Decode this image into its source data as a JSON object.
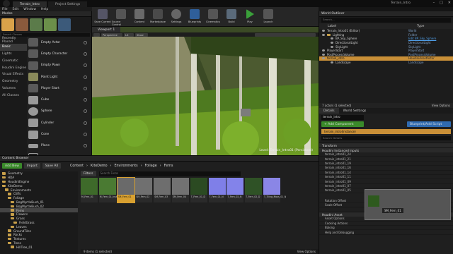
{
  "window": {
    "level_tab": "Terrain_Intro",
    "second_tab": "Project Settings",
    "menus": [
      "File",
      "Edit",
      "Window",
      "Help"
    ]
  },
  "modes": {
    "title": "Modes",
    "search_placeholder": "Search Classes",
    "categories": [
      "Recently Placed",
      "Basic",
      "Lights",
      "Cinematic",
      "Houdini Engine",
      "Visual Effects",
      "Geometry",
      "Volumes",
      "All Classes"
    ],
    "selected_category": "Basic",
    "items": [
      "Empty Actor",
      "Empty Character",
      "Empty Pawn",
      "Point Light",
      "Player Start",
      "Cube",
      "Sphere",
      "Cylinder",
      "Cone",
      "Plane",
      "Box Trigger"
    ]
  },
  "toolbar": {
    "buttons": [
      "Save Current",
      "Source Control",
      "Content",
      "Marketplace",
      "Settings",
      "Blueprints",
      "Cinematics",
      "Build",
      "Play",
      "Launch"
    ]
  },
  "viewport": {
    "tab": "Viewport 1",
    "level_label": "Level: Terrain_Intro01 (Persistent)",
    "perspective": "Perspective",
    "lit": "Lit",
    "show": "Show"
  },
  "outliner": {
    "title": "World Outliner",
    "search_placeholder": "Search...",
    "col_label": "Label",
    "col_type": "Type",
    "rows": [
      {
        "label": "Terrain_Intro01 (Editor)",
        "type": "World",
        "sel": false
      },
      {
        "label": "Lighting",
        "type": "Folder",
        "sel": false
      },
      {
        "label": "BP_Sky_Sphere",
        "type": "Edit BP_Sky_Sphere",
        "sel": false
      },
      {
        "label": "DirectionalLight",
        "type": "DirectionalLight",
        "sel": false
      },
      {
        "label": "SkyLight",
        "type": "SkyLight",
        "sel": false
      },
      {
        "label": "PlayerStart",
        "type": "PlayerStart",
        "sel": false
      },
      {
        "label": "PostProcessVolume",
        "type": "PostProcessVolume",
        "sel": false
      },
      {
        "label": "terrain_intro",
        "type": "HoudiniAssetActor",
        "sel": true
      },
      {
        "label": "Landscape",
        "type": "Landscape",
        "sel": false
      }
    ],
    "footer_count": "7 actors (1 selected)",
    "view_options": "View Options"
  },
  "details": {
    "tab1": "Details",
    "tab2": "World Settings",
    "actor_name": "terrain_intro",
    "add_component": "+ Add Component",
    "blueprint_btn": "Blueprint/Add Script",
    "instance_label": "terrain_intro(Instance)",
    "search_placeholder": "Search Details",
    "transform_section": "Transform",
    "instanced_section": "Houdini Instanced Inputs",
    "sections": [
      "Houdini Asset",
      "Asset Options",
      "Cooking Actions",
      "Baking",
      "Help and Debugging"
    ],
    "instanced_rows": [
      "terrain_intro01_24",
      "terrain_intro01_21",
      "terrain_intro01_19",
      "terrain_intro01_16",
      "terrain_intro01_14",
      "terrain_intro01_11",
      "terrain_intro01_09",
      "terrain_intro01_07",
      "terrain_intro01_05"
    ],
    "input_value": "0.0",
    "preview_label": "SM_Fern_01",
    "rot_offset": "Rotation Offset",
    "scale_offset": "Scale Offset"
  },
  "content_browser": {
    "title": "Content Browser",
    "add_new": "Add New",
    "import": "Import",
    "save_all": "Save All",
    "path": [
      "Content",
      "KiteDemo",
      "Environments",
      "Foliage",
      "Ferns"
    ],
    "filters": "Filters",
    "search_placeholder": "Search Ferns",
    "folders": [
      "Geometry",
      "HDA",
      "HoudiniEngine",
      "KiteDemo",
      "Environments",
      "Cliffs",
      "Foliage",
      "BogMyrtleBush_01",
      "BogMyrtleBush_02",
      "Ferns",
      "Flowers",
      "Grass",
      "FieldGrass",
      "Leaves",
      "GroundTiles",
      "Rocks",
      "Textures",
      "Trees",
      "HillTree_01"
    ],
    "selected_folder": "Ferns",
    "assets": [
      "M_Fern_01",
      "M_Fern_01_Inst",
      "SM_Fern_01",
      "SM_Fern_02",
      "SM_Fern_03",
      "SM_Fern_04",
      "T_Fern_01_D",
      "T_Fern_01_N",
      "T_Fern_02_N",
      "T_Fern_02_D",
      "T_Tiling_Moss_01_N"
    ],
    "selected_asset": "SM_Fern_01",
    "footer": "9 items (1 selected)",
    "view_options": "View Options"
  }
}
